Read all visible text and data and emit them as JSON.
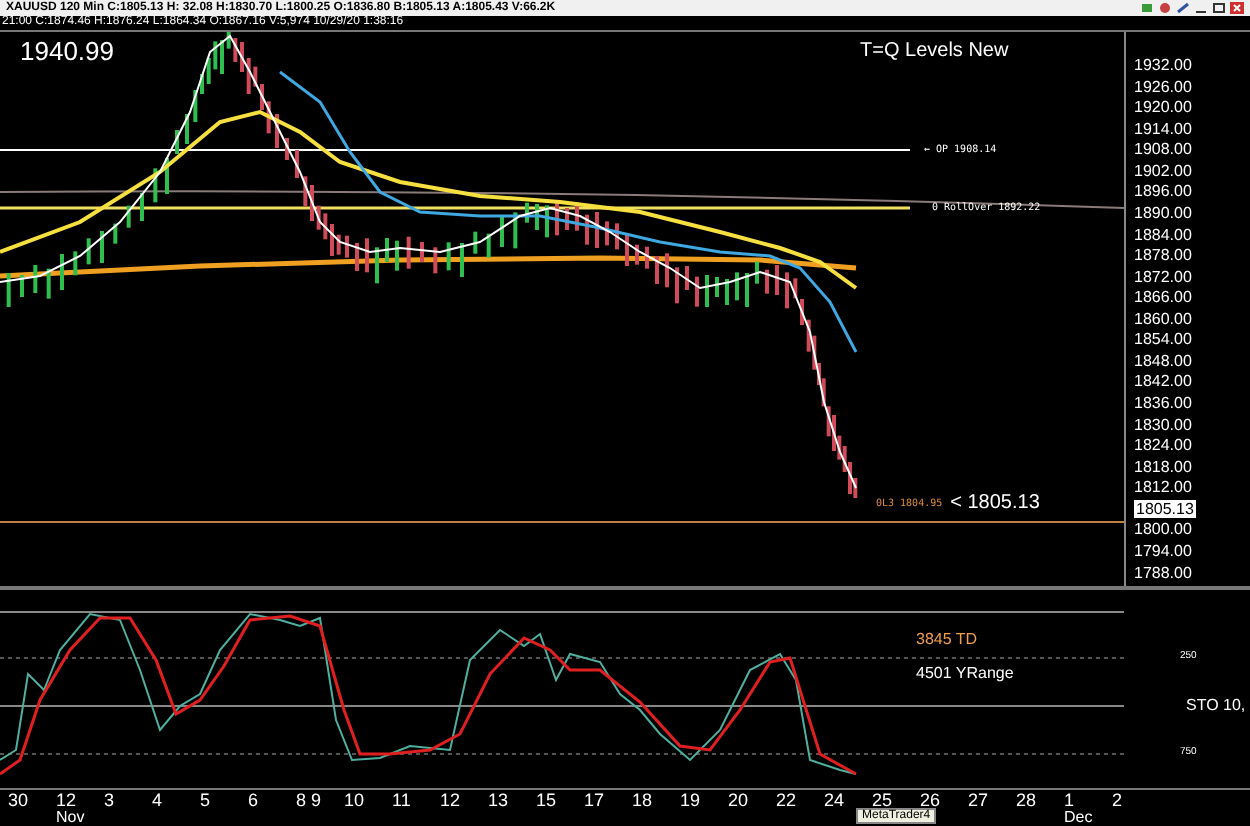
{
  "window": {
    "symbol_bar": "XAUUSD 120 Min  C:1805.13  H: 32.08  H:1830.70  L:1800.25  O:1836.80  B:1805.13  A:1805.43  V:66.2K"
  },
  "info_line": "21:00 C:1874.46 H:1876.24 L:1864.34 O:1867.16 V:5,974 10/29/20 1:38:16",
  "chart": {
    "title": "T=Q Levels New",
    "high_label": "1940.99",
    "price_axis": [
      {
        "label": "1932.00",
        "kind": "tick"
      },
      {
        "label": "1926.00",
        "kind": "tick"
      },
      {
        "label": "1920.00",
        "kind": "tick"
      },
      {
        "label": "1914.00",
        "kind": "tick"
      },
      {
        "label": "1908.00",
        "kind": "tick"
      },
      {
        "label": "1902.00",
        "kind": "tick"
      },
      {
        "label": "1896.00",
        "kind": "tick"
      },
      {
        "label": "1890.00",
        "kind": "tick"
      },
      {
        "label": "1884.00",
        "kind": "tick"
      },
      {
        "label": "1878.00",
        "kind": "tick"
      },
      {
        "label": "1872.00",
        "kind": "tick"
      },
      {
        "label": "1866.00",
        "kind": "tick"
      },
      {
        "label": "1860.00",
        "kind": "tick"
      },
      {
        "label": "1854.00",
        "kind": "tick"
      },
      {
        "label": "1848.00",
        "kind": "tick"
      },
      {
        "label": "1842.00",
        "kind": "tick"
      },
      {
        "label": "1836.00",
        "kind": "tick"
      },
      {
        "label": "1830.00",
        "kind": "tick"
      },
      {
        "label": "1824.00",
        "kind": "tick"
      },
      {
        "label": "1818.00",
        "kind": "tick"
      },
      {
        "label": "1812.00",
        "kind": "tick"
      },
      {
        "label": "1805.13",
        "kind": "current"
      },
      {
        "label": "1800.00",
        "kind": "tick"
      },
      {
        "label": "1794.00",
        "kind": "tick"
      },
      {
        "label": "1788.00",
        "kind": "tick"
      }
    ],
    "levels": [
      {
        "label": "← OP 1908.14",
        "color": "#ffffff"
      },
      {
        "label": "0 RollOver 1892.22",
        "color": "#ffffff"
      },
      {
        "label": "0L3 1804.95",
        "color": "#e08a3a"
      }
    ],
    "price_marker": "< 1805.13"
  },
  "oscillator": {
    "labels": [
      {
        "text": "3845 TD",
        "color": "#f0a050"
      },
      {
        "text": "4501 YRange",
        "color": "#ffffff"
      }
    ],
    "levels": [
      "250",
      "750"
    ],
    "name": "STO  10,"
  },
  "time_axis": {
    "days": [
      {
        "label": "30"
      },
      {
        "label": "12",
        "month": "Nov"
      },
      {
        "label": "3"
      },
      {
        "label": "4"
      },
      {
        "label": "5"
      },
      {
        "label": "6"
      },
      {
        "label": "8 9"
      },
      {
        "label": "10"
      },
      {
        "label": "11"
      },
      {
        "label": "12"
      },
      {
        "label": "13"
      },
      {
        "label": "15"
      },
      {
        "label": "17"
      },
      {
        "label": "18"
      },
      {
        "label": "19"
      },
      {
        "label": "20"
      },
      {
        "label": "22"
      },
      {
        "label": "24"
      },
      {
        "label": "25"
      },
      {
        "label": "26"
      },
      {
        "label": "27"
      },
      {
        "label": "28"
      },
      {
        "label": "1",
        "month": "Dec"
      },
      {
        "label": "2"
      }
    ]
  },
  "tooltip": "MetaTrader4"
}
